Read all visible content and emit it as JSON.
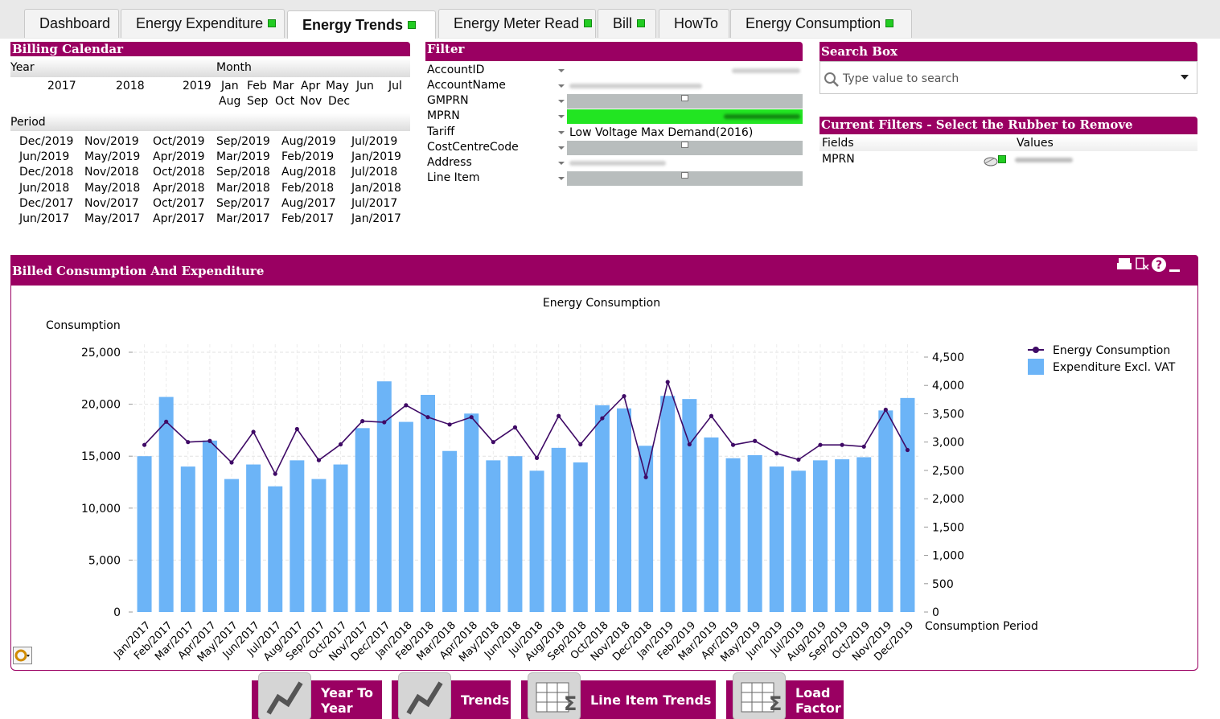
{
  "tabs": [
    {
      "label": "Dashboard",
      "led": false,
      "active": false
    },
    {
      "label": "Energy Expenditure",
      "led": true,
      "active": false
    },
    {
      "label": "Energy Trends",
      "led": true,
      "active": true
    },
    {
      "label": "Energy Meter Read",
      "led": true,
      "active": false
    },
    {
      "label": "Bill",
      "led": true,
      "active": false
    },
    {
      "label": "HowTo",
      "led": false,
      "active": false
    },
    {
      "label": "Energy Consumption",
      "led": true,
      "active": false
    }
  ],
  "billing": {
    "title": "Billing Calendar",
    "year_label": "Year",
    "month_label": "Month",
    "years": [
      "2017",
      "2018",
      "2019"
    ],
    "months_row1": [
      "Jan",
      "Feb",
      "Mar",
      "Apr",
      "May",
      "Jun",
      "Jul"
    ],
    "months_row2": [
      "Aug",
      "Sep",
      "Oct",
      "Nov",
      "Dec"
    ],
    "period_label": "Period",
    "periods": [
      [
        "Dec/2019",
        "Nov/2019",
        "Oct/2019",
        "Sep/2019",
        "Aug/2019",
        "Jul/2019"
      ],
      [
        "Jun/2019",
        "May/2019",
        "Apr/2019",
        "Mar/2019",
        "Feb/2019",
        "Jan/2019"
      ],
      [
        "Dec/2018",
        "Nov/2018",
        "Oct/2018",
        "Sep/2018",
        "Aug/2018",
        "Jul/2018"
      ],
      [
        "Jun/2018",
        "May/2018",
        "Apr/2018",
        "Mar/2018",
        "Feb/2018",
        "Jan/2018"
      ],
      [
        "Dec/2017",
        "Nov/2017",
        "Oct/2017",
        "Sep/2017",
        "Aug/2017",
        "Jul/2017"
      ],
      [
        "Jun/2017",
        "May/2017",
        "Apr/2017",
        "Mar/2017",
        "Feb/2017",
        "Jan/2017"
      ]
    ]
  },
  "filter": {
    "title": "Filter",
    "fields": [
      "AccountID",
      "AccountName",
      "GMPRN",
      "MPRN",
      "Tariff",
      "CostCentreCode",
      "Address",
      "Line Item"
    ],
    "tariff_value": "Low Voltage Max Demand(2016)"
  },
  "search": {
    "title": "Search Box",
    "placeholder": "Type value to search"
  },
  "current_filters": {
    "title": "Current Filters - Select the Rubber to Remove",
    "fields_header": "Fields",
    "values_header": "Values",
    "field": "MPRN"
  },
  "colors": {
    "accent": "#9a0062",
    "bar": "#6cb4f7",
    "line": "#3f0a66",
    "led": "#22cc22"
  },
  "chart_panel_title": "Billed Consumption And Expenditure",
  "chart_data": {
    "type": "bar",
    "title": "Energy Consumption",
    "ylabel": "Consumption",
    "xlabel": "Consumption Period",
    "categories": [
      "Jan/2017",
      "Feb/2017",
      "Mar/2017",
      "Apr/2017",
      "May/2017",
      "Jun/2017",
      "Jul/2017",
      "Aug/2017",
      "Sep/2017",
      "Oct/2017",
      "Nov/2017",
      "Dec/2017",
      "Jan/2018",
      "Feb/2018",
      "Mar/2018",
      "Apr/2018",
      "May/2018",
      "Jun/2018",
      "Jul/2018",
      "Aug/2018",
      "Sep/2018",
      "Oct/2018",
      "Nov/2018",
      "Dec/2018",
      "Jan/2019",
      "Feb/2019",
      "Mar/2019",
      "Apr/2019",
      "May/2019",
      "Jun/2019",
      "Jul/2019",
      "Aug/2019",
      "Sep/2019",
      "Oct/2019",
      "Nov/2019",
      "Dec/2019"
    ],
    "ylim_left": [
      0,
      25000
    ],
    "yticks_left": [
      "0",
      "5,000",
      "10,000",
      "15,000",
      "20,000",
      "25,000"
    ],
    "ylim_right": [
      0,
      4500
    ],
    "yticks_right": [
      "0",
      "500",
      "1,000",
      "1,500",
      "2,000",
      "2,500",
      "3,000",
      "3,500",
      "4,000",
      "4,500"
    ],
    "legend_position": "top-right",
    "series": [
      {
        "name": "Expenditure Excl. VAT",
        "kind": "bar",
        "axis": "left",
        "values": [
          15000,
          20700,
          14000,
          16500,
          12800,
          14200,
          12100,
          14600,
          12800,
          14200,
          17700,
          22200,
          18300,
          20900,
          15500,
          19100,
          14600,
          15000,
          13600,
          15800,
          14400,
          19900,
          19600,
          16000,
          20800,
          20500,
          16800,
          14800,
          15100,
          14000,
          13600,
          14600,
          14700,
          14900,
          19400,
          20600
        ]
      },
      {
        "name": "Energy Consumption",
        "kind": "line",
        "axis": "right",
        "values": [
          2950,
          3360,
          3000,
          3020,
          2640,
          3180,
          2440,
          3230,
          2680,
          2960,
          3370,
          3350,
          3650,
          3440,
          3310,
          3440,
          3000,
          3260,
          2720,
          3460,
          2960,
          3420,
          3810,
          2380,
          4060,
          2960,
          3460,
          2950,
          3020,
          2800,
          2690,
          2950,
          2950,
          2920,
          3570,
          2860
        ]
      }
    ]
  },
  "bottom_buttons": [
    {
      "line1": "Year To",
      "line2": "Year",
      "icon": "line-chart-icon"
    },
    {
      "line1": "Trends",
      "line2": "",
      "icon": "line-chart-icon"
    },
    {
      "line1": "Line Item Trends",
      "line2": "",
      "icon": "sum-table-icon"
    },
    {
      "line1": "Load",
      "line2": "Factor",
      "icon": "sum-table-icon"
    }
  ]
}
